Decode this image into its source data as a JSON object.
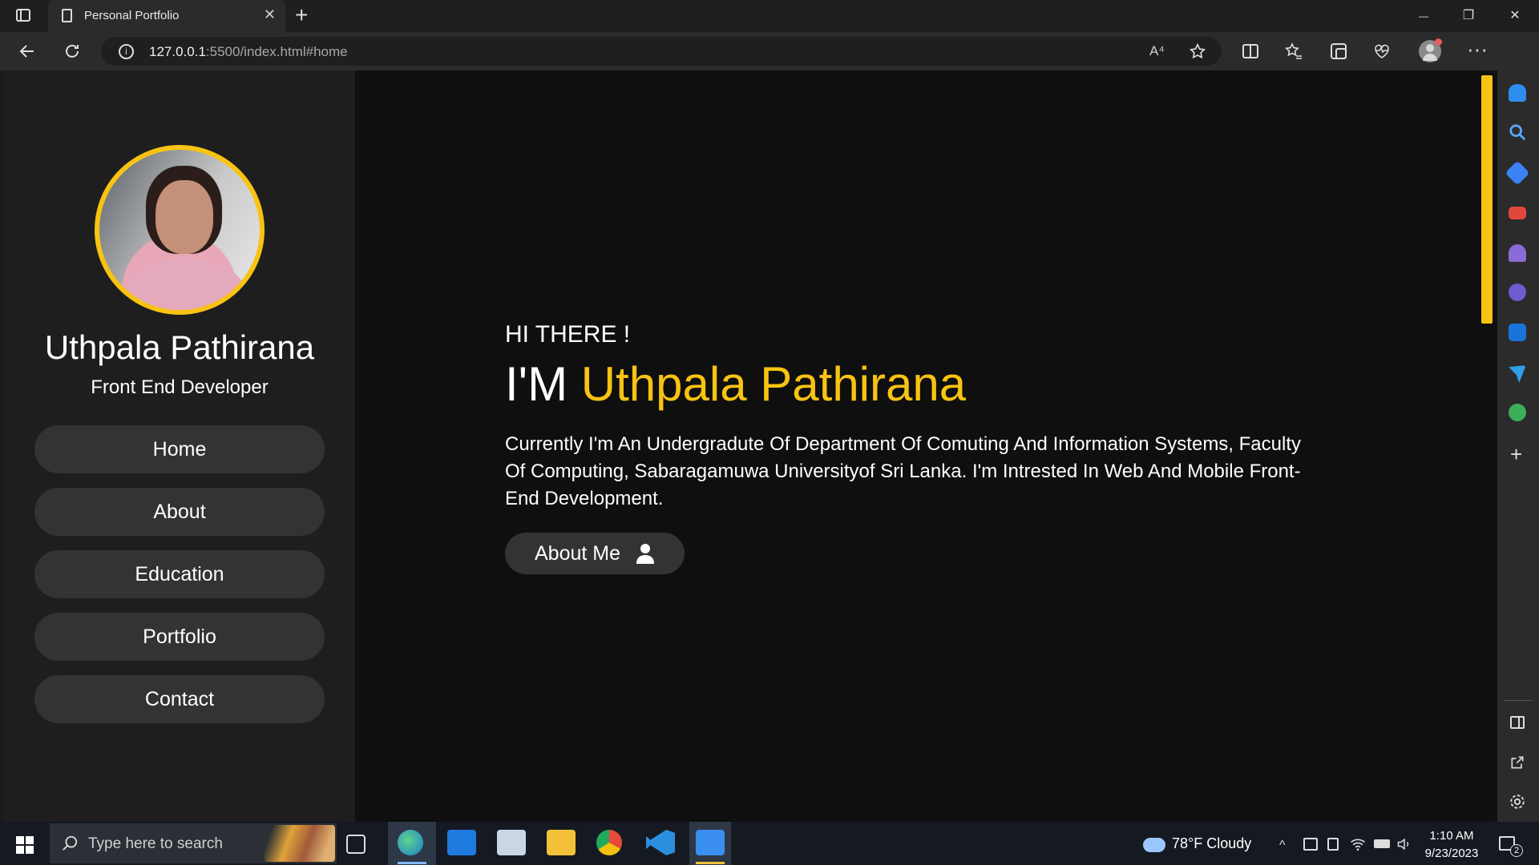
{
  "browser": {
    "tab_title": "Personal Portfolio",
    "tab_close": "✕",
    "new_tab": "+",
    "url_host": "127.0.0.1",
    "url_rest": ":5500/index.html#home",
    "read_aloud": "A⁴",
    "icons": [
      "sidebar-toggle-icon",
      "page-icon",
      "back-icon",
      "refresh-icon",
      "info-icon",
      "read-aloud-icon",
      "favorite-star-icon",
      "split-screen-icon",
      "favorites-icon",
      "collections-icon",
      "performance-icon",
      "profile-icon",
      "more-icon",
      "bing-icon"
    ]
  },
  "window_controls": {
    "minimize": "—",
    "restore": "❐",
    "close": "✕"
  },
  "sidebar": {
    "name": "Uthpala Pathirana",
    "role": "Front End Developer",
    "nav": [
      {
        "label": "Home"
      },
      {
        "label": "About"
      },
      {
        "label": "Education"
      },
      {
        "label": "Portfolio"
      },
      {
        "label": "Contact"
      }
    ]
  },
  "hero": {
    "greeting": "HI THERE !",
    "im": "I'M ",
    "name": "Uthpala Pathirana",
    "description": "Currently I'm An Undergradute Of Department Of Comuting And Information Systems, Faculty Of Computing, Sabaragamuwa Universityof Sri Lanka. I'm Intrested In Web And Mobile Front-End Development.",
    "button_label": "About Me"
  },
  "colors": {
    "accent": "#f8c312",
    "page_bg": "#0f0f0f",
    "sidebar_bg": "#1e1e1e",
    "button_bg": "#333333"
  },
  "edge_sidebar": {
    "icons": [
      "bell-icon",
      "search-icon",
      "tag-icon",
      "briefcase-icon",
      "chess-icon",
      "office-icon",
      "outlook-icon",
      "send-icon",
      "tree-icon",
      "add-icon",
      "panel-icon",
      "external-link-icon",
      "settings-icon"
    ],
    "add": "+"
  },
  "taskbar": {
    "search_placeholder": "Type here to search",
    "weather": "78°F  Cloudy",
    "time": "1:10 AM",
    "date": "9/23/2023",
    "notification_count": "2",
    "apps": [
      "task-view-icon",
      "edge-icon",
      "mail-icon",
      "app-icon",
      "file-explorer-icon",
      "chrome-icon",
      "vscode-icon",
      "media-icon"
    ]
  }
}
